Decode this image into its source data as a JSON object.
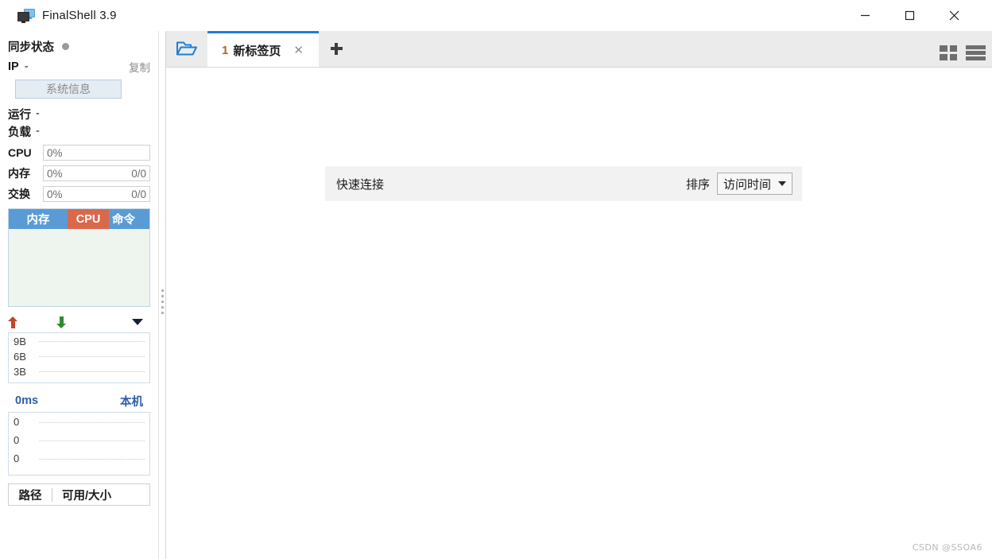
{
  "window": {
    "title": "FinalShell 3.9",
    "icon": "monitors-icon",
    "controls": {
      "minimize": "–",
      "maximize": "□",
      "close": "✕"
    }
  },
  "sidebar": {
    "sync": {
      "label": "同步状态",
      "status_color": "#9a9a9a"
    },
    "ip": {
      "label": "IP",
      "value": "-",
      "copy_label": "复制"
    },
    "system_info_button": "系统信息",
    "uptime": {
      "label": "运行",
      "value": "-"
    },
    "load": {
      "label": "负载",
      "value": "-"
    },
    "meters": [
      {
        "label": "CPU",
        "percent": "0%",
        "detail": ""
      },
      {
        "label": "内存",
        "percent": "0%",
        "detail": "0/0"
      },
      {
        "label": "交换",
        "percent": "0%",
        "detail": "0/0"
      }
    ],
    "process_tabs": [
      {
        "label": "内存",
        "color": "#5b9bd5",
        "active": false
      },
      {
        "label": "CPU",
        "color": "#d9694a",
        "active": true
      },
      {
        "label": "命令",
        "color": "#5b9bd5",
        "active": false
      }
    ],
    "network": {
      "upload_icon": "arrow-up-icon",
      "download_icon": "arrow-down-icon",
      "menu_icon": "caret-down-icon",
      "axis_labels": [
        "9B",
        "6B",
        "3B"
      ]
    },
    "ping": {
      "latency": "0ms",
      "host": "本机",
      "axis_labels": [
        "0",
        "0",
        "0"
      ]
    },
    "disk_header": {
      "path": "路径",
      "usage": "可用/大小"
    }
  },
  "tabbar": {
    "folder_icon": "open-folder-icon",
    "tab": {
      "number": "1",
      "label": "新标签页",
      "close": "✕"
    },
    "add_label": "+",
    "view_grid_icon": "grid-view-icon",
    "view_list_icon": "list-view-icon"
  },
  "quick_connect": {
    "title": "快速连接",
    "sort_label": "排序",
    "sort_value": "访问时间",
    "sort_options": [
      "访问时间"
    ]
  },
  "watermark": "CSDN @SSOA6",
  "colors": {
    "accent_blue": "#1d7fd6",
    "tab_blue": "#5b9bd5",
    "cpu_orange": "#d9694a",
    "panel_gray": "#f2f2f2",
    "tabbar_gray": "#ebebeb"
  }
}
